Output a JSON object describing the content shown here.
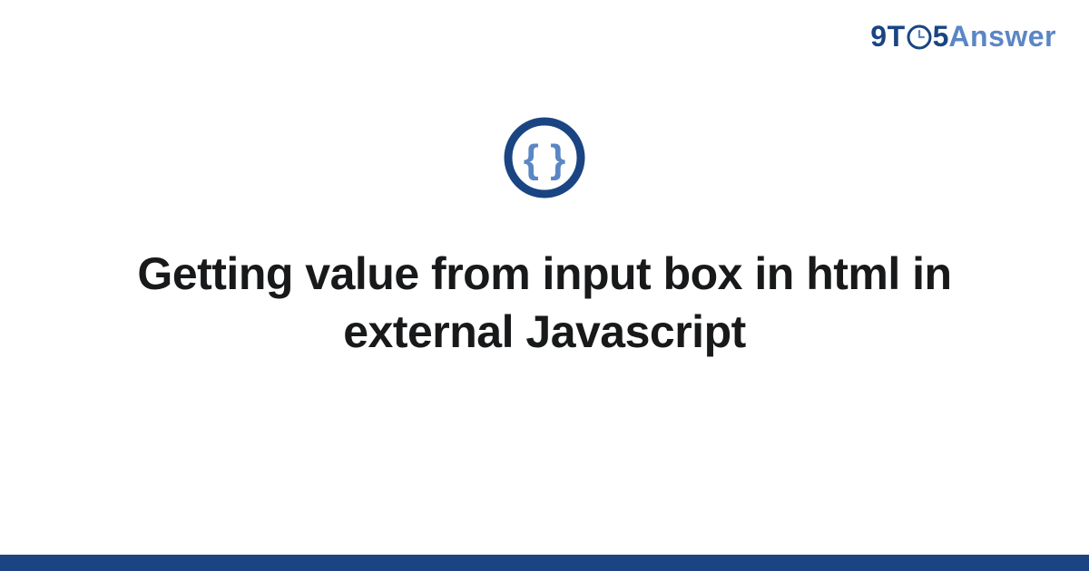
{
  "brand": {
    "prefix": "9T",
    "middle": "5",
    "suffix": "Answer"
  },
  "title": "Getting value from input box in html in external Javascript"
}
